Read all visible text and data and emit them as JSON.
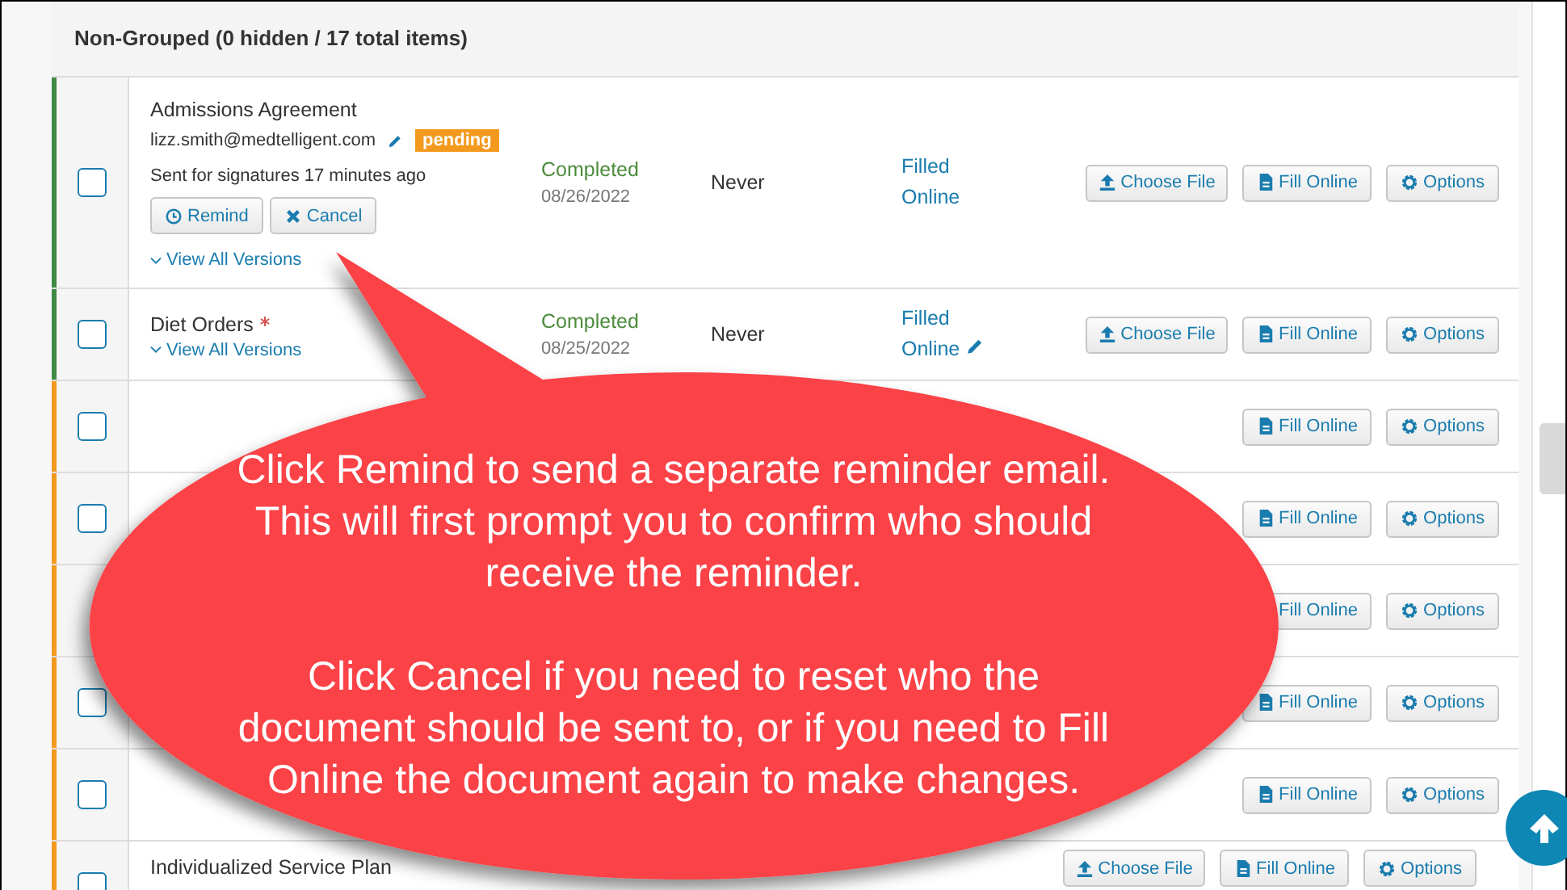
{
  "section": {
    "title": "Non-Grouped (0 hidden / 17 total items)"
  },
  "rows": [
    {
      "color": "#3f8a45",
      "checked": false,
      "name": "Admissions Agreement",
      "required": false,
      "email": "lizz.smith@medtelligent.com",
      "badge": "pending",
      "sent": "Sent for signatures 17 minutes ago",
      "actions": [
        {
          "kind": "clock",
          "label": "Remind"
        },
        {
          "kind": "cross",
          "label": "Cancel"
        }
      ],
      "versions": "View All Versions",
      "status": "Completed",
      "complete": true,
      "date": "08/26/2022",
      "reminder": "Never",
      "fill": "Filled Online",
      "editable": false,
      "buttons": [
        {
          "kind": "upload",
          "label": "Choose File"
        },
        {
          "kind": "file",
          "label": "Fill Online"
        },
        {
          "kind": "gear",
          "label": "Options"
        }
      ]
    },
    {
      "color": "#3f8a45",
      "checked": false,
      "name": "Diet Orders",
      "required": true,
      "versions": "View All Versions",
      "status": "Completed",
      "complete": true,
      "date": "08/25/2022",
      "reminder": "Never",
      "fill": "Filled Online",
      "editable": true,
      "buttons": [
        {
          "kind": "upload",
          "label": "Choose File"
        },
        {
          "kind": "file",
          "label": "Fill Online"
        },
        {
          "kind": "gear",
          "label": "Options"
        }
      ]
    },
    {
      "color": "#f39a1e",
      "checked": false,
      "buttons": [
        {
          "kind": "file",
          "label": "Fill Online"
        },
        {
          "kind": "gear",
          "label": "Options"
        }
      ]
    },
    {
      "color": "#f39a1e",
      "checked": false,
      "buttons": [
        {
          "kind": "file",
          "label": "Fill Online"
        },
        {
          "kind": "gear",
          "label": "Options"
        }
      ]
    },
    {
      "color": "#f39a1e",
      "buttons": [
        {
          "kind": "file",
          "label": "Fill Online"
        },
        {
          "kind": "gear",
          "label": "Options"
        }
      ]
    },
    {
      "color": "#f39a1e",
      "checked": false,
      "buttons": [
        {
          "kind": "file",
          "label": "Fill Online"
        },
        {
          "kind": "gear",
          "label": "Options"
        }
      ]
    },
    {
      "color": "#f39a1e",
      "checked": false,
      "buttons": [
        {
          "kind": "file",
          "label": "Fill Online"
        },
        {
          "kind": "gear",
          "label": "Options"
        }
      ]
    },
    {
      "color": "#f39a1e",
      "checked": false,
      "name": "Individualized Service Plan",
      "required": false,
      "buttons": [
        {
          "kind": "upload",
          "label": "Choose File"
        },
        {
          "kind": "file",
          "label": "Fill Online"
        },
        {
          "kind": "gear",
          "label": "Options"
        }
      ]
    }
  ],
  "callout": {
    "paragraphs": [
      "Click Remind to send a separate reminder email.\nThis will first prompt you to confirm who should\nreceive the reminder.",
      "Click Cancel if you need to reset who the\ndocument should be sent to, or if you need to Fill\nOnline the document again to make changes."
    ]
  }
}
